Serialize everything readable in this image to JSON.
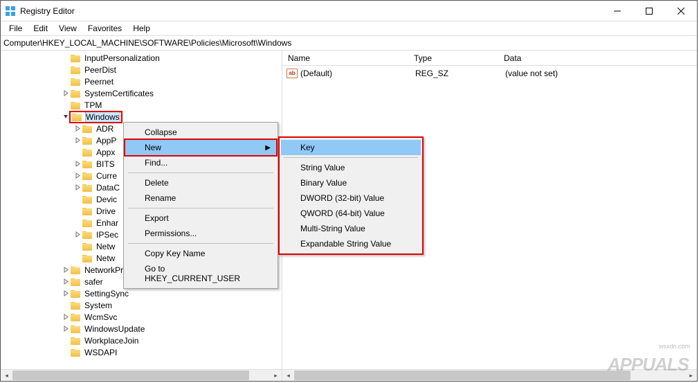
{
  "title": "Registry Editor",
  "menubar": [
    "File",
    "Edit",
    "View",
    "Favorites",
    "Help"
  ],
  "address": "Computer\\HKEY_LOCAL_MACHINE\\SOFTWARE\\Policies\\Microsoft\\Windows",
  "tree": [
    {
      "indent": 88,
      "expand": "none",
      "label": "InputPersonalization",
      "selected": false
    },
    {
      "indent": 88,
      "expand": "none",
      "label": "PeerDist",
      "selected": false
    },
    {
      "indent": 88,
      "expand": "none",
      "label": "Peernet",
      "selected": false
    },
    {
      "indent": 88,
      "expand": "closed",
      "label": "SystemCertificates",
      "selected": false
    },
    {
      "indent": 88,
      "expand": "none",
      "label": "TPM",
      "selected": false
    },
    {
      "indent": 88,
      "expand": "open",
      "label": "Windows",
      "selected": true
    },
    {
      "indent": 105,
      "expand": "closed",
      "label": "ADR",
      "selected": false
    },
    {
      "indent": 105,
      "expand": "closed",
      "label": "AppP",
      "selected": false
    },
    {
      "indent": 105,
      "expand": "none",
      "label": "Appx",
      "selected": false
    },
    {
      "indent": 105,
      "expand": "closed",
      "label": "BITS",
      "selected": false
    },
    {
      "indent": 105,
      "expand": "closed",
      "label": "Curre",
      "selected": false
    },
    {
      "indent": 105,
      "expand": "closed",
      "label": "DataC",
      "selected": false
    },
    {
      "indent": 105,
      "expand": "none",
      "label": "Devic",
      "selected": false
    },
    {
      "indent": 105,
      "expand": "none",
      "label": "Drive",
      "selected": false
    },
    {
      "indent": 105,
      "expand": "none",
      "label": "Enhar",
      "selected": false
    },
    {
      "indent": 105,
      "expand": "closed",
      "label": "IPSec",
      "selected": false
    },
    {
      "indent": 105,
      "expand": "none",
      "label": "Netw",
      "selected": false
    },
    {
      "indent": 105,
      "expand": "none",
      "label": "Netw",
      "selected": false
    },
    {
      "indent": 88,
      "expand": "closed",
      "label": "NetworkProvider",
      "selected": false
    },
    {
      "indent": 88,
      "expand": "closed",
      "label": "safer",
      "selected": false
    },
    {
      "indent": 88,
      "expand": "closed",
      "label": "SettingSync",
      "selected": false
    },
    {
      "indent": 88,
      "expand": "none",
      "label": "System",
      "selected": false
    },
    {
      "indent": 88,
      "expand": "closed",
      "label": "WcmSvc",
      "selected": false
    },
    {
      "indent": 88,
      "expand": "closed",
      "label": "WindowsUpdate",
      "selected": false
    },
    {
      "indent": 88,
      "expand": "none",
      "label": "WorkplaceJoin",
      "selected": false
    },
    {
      "indent": 88,
      "expand": "none",
      "label": "WSDAPI",
      "selected": false
    }
  ],
  "list": {
    "headers": {
      "name": "Name",
      "type": "Type",
      "data": "Data"
    },
    "rows": [
      {
        "name": "(Default)",
        "type": "REG_SZ",
        "data": "(value not set)"
      }
    ]
  },
  "context_main": [
    {
      "label": "Collapse",
      "highlight": false,
      "arrow": false
    },
    {
      "label": "New",
      "highlight": true,
      "arrow": true
    },
    {
      "label": "Find...",
      "highlight": false,
      "arrow": false
    },
    {
      "sep": true
    },
    {
      "label": "Delete",
      "highlight": false,
      "arrow": false
    },
    {
      "label": "Rename",
      "highlight": false,
      "arrow": false
    },
    {
      "sep": true
    },
    {
      "label": "Export",
      "highlight": false,
      "arrow": false
    },
    {
      "label": "Permissions...",
      "highlight": false,
      "arrow": false
    },
    {
      "sep": true
    },
    {
      "label": "Copy Key Name",
      "highlight": false,
      "arrow": false
    },
    {
      "label": "Go to HKEY_CURRENT_USER",
      "highlight": false,
      "arrow": false
    }
  ],
  "context_sub": [
    {
      "label": "Key",
      "highlight": true
    },
    {
      "sep": true
    },
    {
      "label": "String Value",
      "highlight": false
    },
    {
      "label": "Binary Value",
      "highlight": false
    },
    {
      "label": "DWORD (32-bit) Value",
      "highlight": false
    },
    {
      "label": "QWORD (64-bit) Value",
      "highlight": false
    },
    {
      "label": "Multi-String Value",
      "highlight": false
    },
    {
      "label": "Expandable String Value",
      "highlight": false
    }
  ],
  "watermark": "APPUALS",
  "wsxdn": "wsxdn.com"
}
